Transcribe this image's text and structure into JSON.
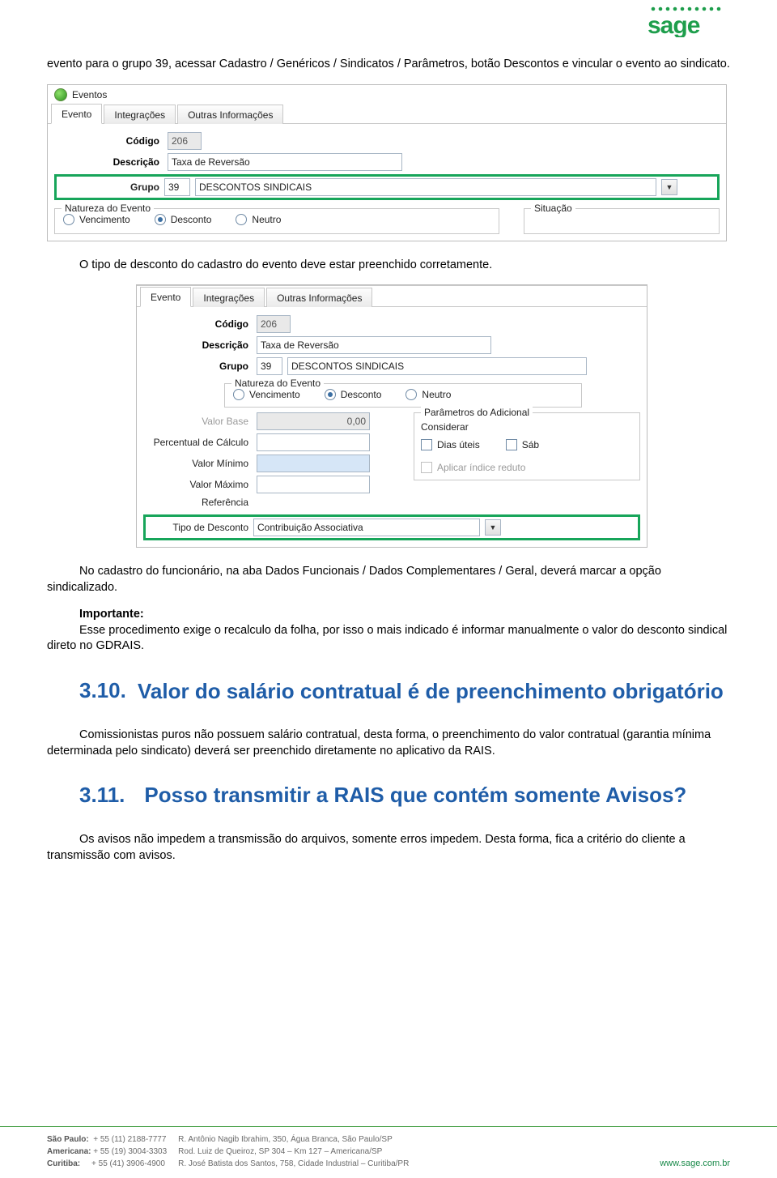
{
  "logo_text": "sage",
  "para1": "evento para o grupo 39, acessar Cadastro / Genéricos / Sindicatos / Parâmetros, botão Descontos e vincular o evento ao sindicato.",
  "para2": "O tipo de desconto do cadastro do evento deve estar preenchido corretamente.",
  "para3": "No cadastro do funcionário, na aba Dados Funcionais / Dados Complementares / Geral, deverá marcar a opção sindicalizado.",
  "importante_label": "Importante:",
  "importante_text": "Esse procedimento exige o recalculo da folha, por isso o mais indicado é informar manualmente o valor do desconto sindical direto no GDRAIS.",
  "section310": {
    "num": "3.10.",
    "title": "Valor do salário contratual é de preenchimento obrigatório",
    "body": "Comissionistas puros não possuem salário contratual, desta forma, o preenchimento do valor contratual (garantia mínima determinada pelo sindicato) deverá ser preenchido diretamente no aplicativo da RAIS."
  },
  "section311": {
    "num": "3.11.",
    "title": "Posso transmitir a RAIS que contém somente Avisos?",
    "body": "Os avisos não impedem a transmissão do arquivos, somente erros impedem. Desta forma, fica a critério do cliente a transmissão com avisos."
  },
  "win_common": {
    "window_title": "Eventos",
    "tabs": {
      "evento": "Evento",
      "integracoes": "Integrações",
      "outras": "Outras Informações"
    },
    "labels": {
      "codigo": "Código",
      "descricao": "Descrição",
      "grupo": "Grupo",
      "natureza": "Natureza do Evento",
      "situacao": "Situação",
      "vencimento": "Vencimento",
      "desconto": "Desconto",
      "neutro": "Neutro"
    },
    "values": {
      "codigo": "206",
      "descricao": "Taxa de Reversão",
      "grupo_num": "39",
      "grupo_desc": "DESCONTOS SINDICAIS"
    }
  },
  "win2_extra": {
    "labels": {
      "valor_base": "Valor Base",
      "percentual": "Percentual de Cálculo",
      "valor_min": "Valor Mínimo",
      "valor_max": "Valor Máximo",
      "referencia": "Referência",
      "tipo_desconto": "Tipo de Desconto",
      "param_adic": "Parâmetros do Adicional",
      "considerar": "Considerar",
      "dias_uteis": "Dias úteis",
      "sab": "Sáb",
      "aplicar_indice": "Aplicar índice reduto"
    },
    "values": {
      "valor_base": "0,00",
      "tipo_desconto": "Contribuição Associativa"
    }
  },
  "footer": {
    "cities": [
      {
        "name": "São Paulo:",
        "phone": "+ 55 (11) 2188-7777"
      },
      {
        "name": "Americana:",
        "phone": "+ 55 (19) 3004-3303"
      },
      {
        "name": "Curitiba:",
        "phone": "+ 55 (41) 3906-4900"
      }
    ],
    "addresses": [
      "R. Antônio Nagib Ibrahim, 350, Água Branca, São Paulo/SP",
      "Rod. Luiz de Queiroz, SP 304 – Km 127 – Americana/SP",
      "R. José Batista dos Santos, 758, Cidade Industrial – Curitiba/PR"
    ],
    "site": "www.sage.com.br"
  }
}
